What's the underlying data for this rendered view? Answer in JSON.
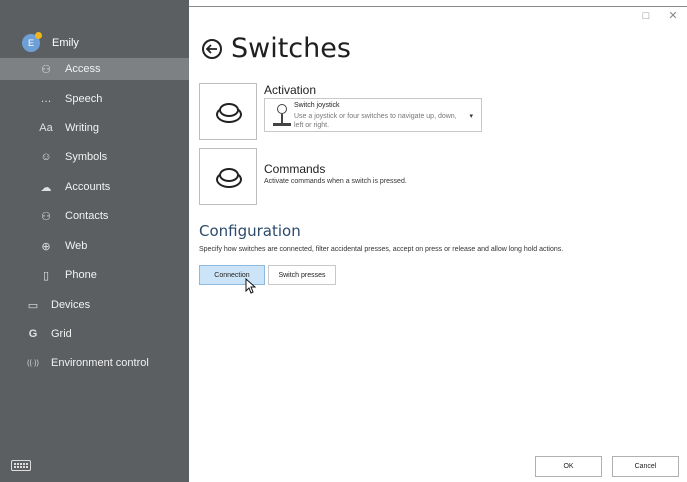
{
  "sidebar": {
    "profile": {
      "name": "Emily",
      "avatar_letter": "E"
    },
    "items": [
      {
        "label": "Access",
        "icon": "person-arms-icon",
        "glyph": "⚇",
        "active": true,
        "level": "sub"
      },
      {
        "label": "Speech",
        "icon": "speech-bubble-icon",
        "glyph": "…",
        "active": false,
        "level": "sub"
      },
      {
        "label": "Writing",
        "icon": "text-aa-icon",
        "glyph": "Aa",
        "active": false,
        "level": "sub"
      },
      {
        "label": "Symbols",
        "icon": "smiley-icon",
        "glyph": "☺",
        "active": false,
        "level": "sub"
      },
      {
        "label": "Accounts",
        "icon": "cloud-icon",
        "glyph": "☁",
        "active": false,
        "level": "sub"
      },
      {
        "label": "Contacts",
        "icon": "people-icon",
        "glyph": "⚇",
        "active": false,
        "level": "sub"
      },
      {
        "label": "Web",
        "icon": "globe-icon",
        "glyph": "⊕",
        "active": false,
        "level": "sub"
      },
      {
        "label": "Phone",
        "icon": "phone-icon",
        "glyph": "▯",
        "active": false,
        "level": "sub"
      },
      {
        "label": "Devices",
        "icon": "monitor-icon",
        "glyph": "▭",
        "active": false,
        "level": "top"
      },
      {
        "label": "Grid",
        "icon": "grid-g-icon",
        "glyph": "G",
        "active": false,
        "level": "top"
      },
      {
        "label": "Environment control",
        "icon": "wireless-signal-icon",
        "glyph": "((·))",
        "active": false,
        "level": "top"
      }
    ],
    "keyboard_icon": "keyboard-icon"
  },
  "window": {
    "maximize": "□",
    "close": "✕"
  },
  "page": {
    "title": "Switches"
  },
  "activation": {
    "heading": "Activation",
    "dropdown": {
      "title": "Switch joystick",
      "description": "Use a joystick or four switches to navigate up, down, left or right.",
      "arrow": "▾"
    }
  },
  "commands": {
    "heading": "Commands",
    "description": "Activate commands when a switch is pressed."
  },
  "configuration": {
    "heading": "Configuration",
    "description": "Specify how switches are connected, filter accidental presses, accept on press or release and allow long hold actions.",
    "buttons": [
      {
        "label": "Connection",
        "selected": true
      },
      {
        "label": "Switch presses",
        "selected": false
      }
    ]
  },
  "footer": {
    "ok_label": "OK",
    "cancel_label": "Cancel"
  }
}
